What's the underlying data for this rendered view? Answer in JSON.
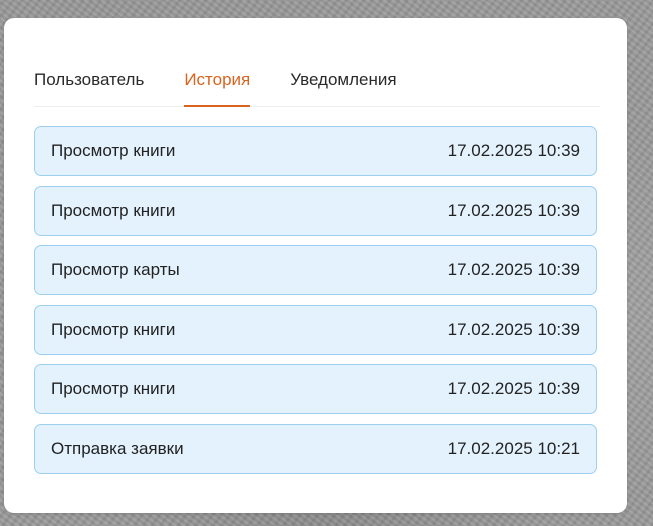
{
  "tabs": [
    {
      "label": "Пользователь",
      "active": false
    },
    {
      "label": "История",
      "active": true
    },
    {
      "label": "Уведомления",
      "active": false
    }
  ],
  "history": [
    {
      "action": "Просмотр книги",
      "timestamp": "17.02.2025 10:39"
    },
    {
      "action": "Просмотр книги",
      "timestamp": "17.02.2025 10:39"
    },
    {
      "action": "Просмотр карты",
      "timestamp": "17.02.2025 10:39"
    },
    {
      "action": "Просмотр книги",
      "timestamp": "17.02.2025 10:39"
    },
    {
      "action": "Просмотр книги",
      "timestamp": "17.02.2025 10:39"
    },
    {
      "action": "Отправка заявки",
      "timestamp": "17.02.2025 10:21"
    }
  ],
  "colors": {
    "accent": "#d9641f",
    "item_background": "#e3f2fd",
    "item_border": "#9ccff0"
  }
}
